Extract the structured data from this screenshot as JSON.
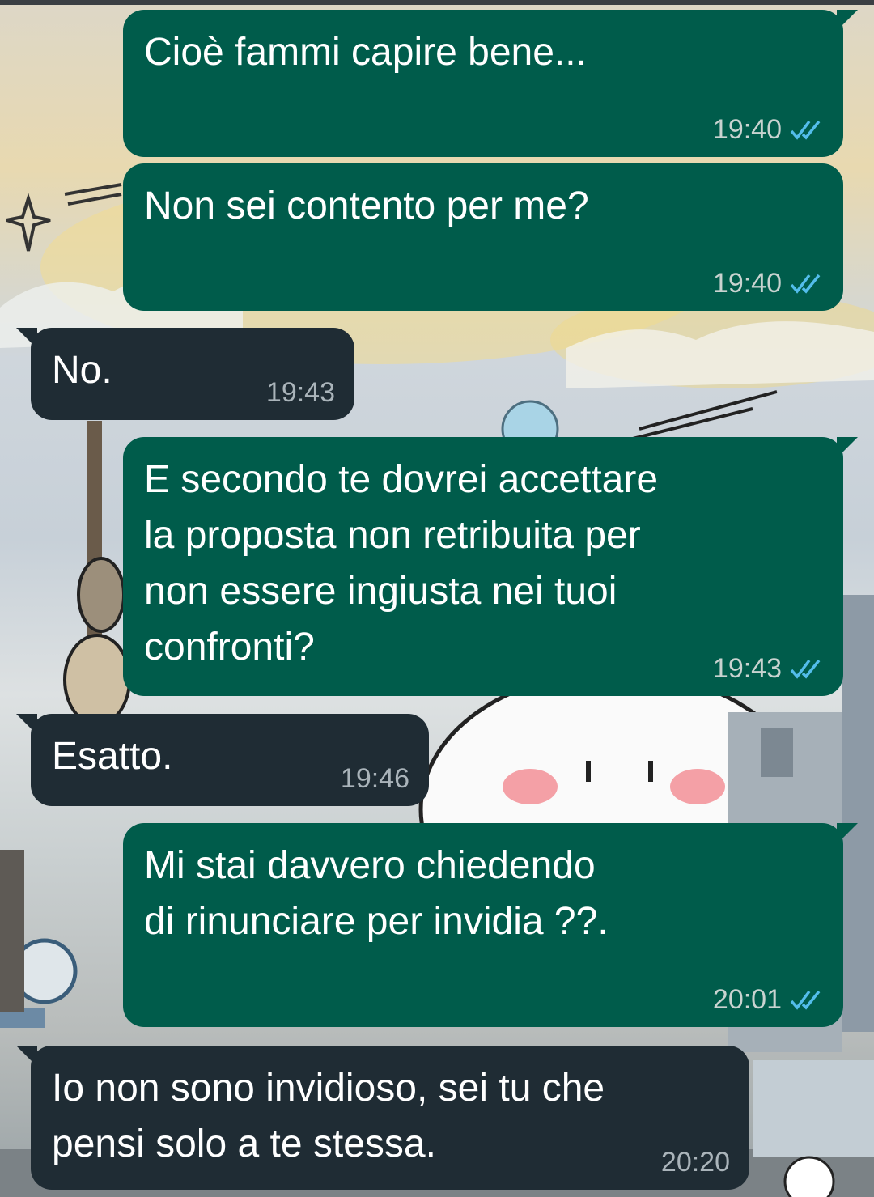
{
  "chat": {
    "messages": [
      {
        "direction": "outgoing",
        "text": "Cioè fammi capire bene...",
        "time": "19:40",
        "status": "read-double-check-icon"
      },
      {
        "direction": "outgoing",
        "text": "Non sei contento per me?",
        "time": "19:40",
        "status": "read-double-check-icon"
      },
      {
        "direction": "incoming",
        "text": "No.",
        "time": "19:43"
      },
      {
        "direction": "outgoing",
        "text": "E secondo te dovrei accettare\nla proposta non retribuita per\nnon essere ingiusta nei tuoi\nconfronti?",
        "time": "19:43",
        "status": "read-double-check-icon"
      },
      {
        "direction": "incoming",
        "text": "Esatto.",
        "time": "19:46"
      },
      {
        "direction": "outgoing",
        "text": "Mi stai davvero chiedendo\ndi rinunciare per invidia ??.",
        "time": "20:01",
        "status": "read-double-check-icon"
      },
      {
        "direction": "incoming",
        "text": "Io non sono invidioso, sei tu che\npensi solo a te stessa.",
        "time": "20:20"
      }
    ]
  },
  "colors": {
    "outgoing_bubble": "#005c4b",
    "incoming_bubble": "#1f2c34",
    "read_tick": "#53bdeb"
  }
}
